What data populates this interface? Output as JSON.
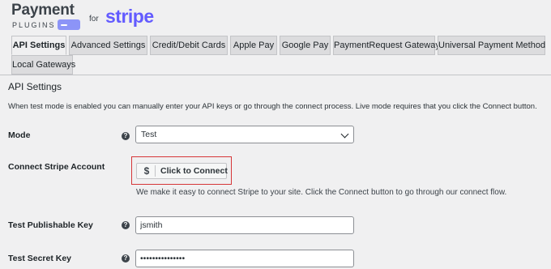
{
  "logo": {
    "payment": "Payment",
    "plugins": "PLUGINS",
    "for": "for",
    "stripe": "stripe"
  },
  "tabs": [
    {
      "label": "API Settings",
      "active": true
    },
    {
      "label": "Advanced Settings"
    },
    {
      "label": "Credit/Debit Cards"
    },
    {
      "label": "Apple Pay"
    },
    {
      "label": "Google Pay"
    },
    {
      "label": "PaymentRequest Gateway"
    },
    {
      "label": "Universal Payment Method"
    },
    {
      "label": "Local Gateways"
    }
  ],
  "section": {
    "title": "API Settings",
    "description": "When test mode is enabled you can manually enter your API keys or go through the connect process. Live mode requires that you click the Connect button."
  },
  "fields": {
    "mode": {
      "label": "Mode",
      "value": "Test"
    },
    "connect": {
      "label": "Connect Stripe Account",
      "button": "Click to Connect",
      "icon": "$",
      "description": "We make it easy to connect Stripe to your site. Click the Connect button to go through our connect flow."
    },
    "publishable_key": {
      "label": "Test Publishable Key",
      "value": "jsmith"
    },
    "secret_key": {
      "label": "Test Secret Key",
      "value": "•••••••••••••••"
    }
  },
  "help_icon": "?",
  "colors": {
    "stripe": "#635bff",
    "highlight": "#d63638"
  }
}
